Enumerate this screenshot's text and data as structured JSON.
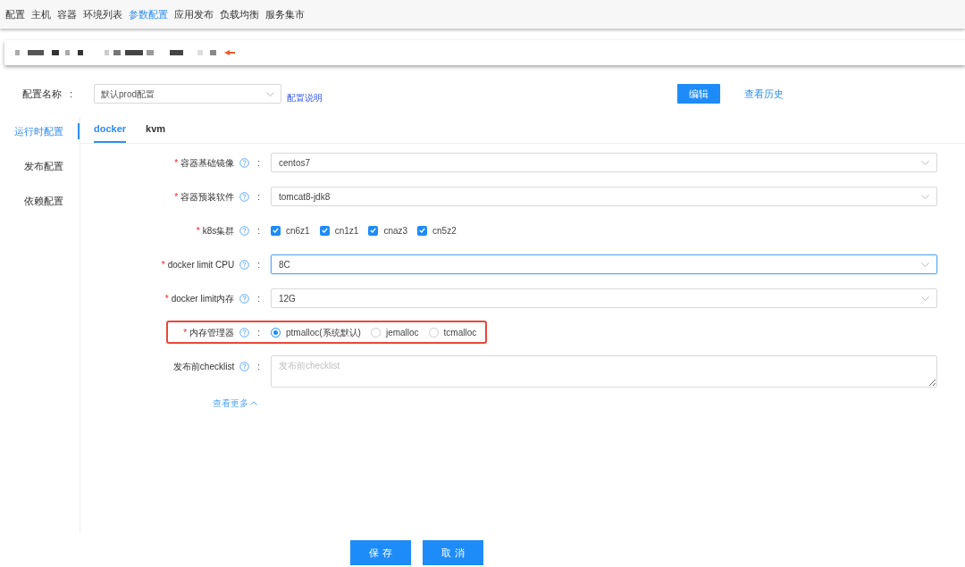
{
  "nav": [
    {
      "label": "配置",
      "selected": false
    },
    {
      "label": "主机",
      "selected": false
    },
    {
      "label": "容器",
      "selected": false
    },
    {
      "label": "环境列表",
      "selected": false
    },
    {
      "label": "参数配置",
      "selected": true
    },
    {
      "label": "应用发布",
      "selected": false
    },
    {
      "label": "负载均衡",
      "selected": false
    },
    {
      "label": "服务集市",
      "selected": false
    }
  ],
  "config_name": {
    "label": "配置名称",
    "colon": ":",
    "value": "默认prod配置",
    "help_link": "配置说明"
  },
  "actions": {
    "edit": "编辑",
    "history": "查看历史"
  },
  "side_tabs": [
    {
      "label": "运行时配置",
      "selected": true
    },
    {
      "label": "发布配置",
      "selected": false
    },
    {
      "label": "依赖配置",
      "selected": false
    }
  ],
  "tabs": [
    {
      "label": "docker",
      "selected": true
    },
    {
      "label": "kvm",
      "selected": false
    }
  ],
  "fields": [
    {
      "kind": "select",
      "required_mark": "*",
      "label": "容器基础镜像",
      "colon": ":",
      "focused": false,
      "highlighted": false,
      "value": "centos7"
    },
    {
      "kind": "select",
      "required_mark": "*",
      "label": "容器预装软件",
      "colon": ":",
      "focused": false,
      "highlighted": false,
      "value": "tomcat8-jdk8"
    },
    {
      "kind": "checkboxes",
      "required_mark": "*",
      "label": "k8s集群",
      "colon": ":",
      "highlighted": false,
      "options": [
        {
          "label": "cn6z1",
          "checked": true
        },
        {
          "label": "cn1z1",
          "checked": true
        },
        {
          "label": "cnaz3",
          "checked": true
        },
        {
          "label": "cn5z2",
          "checked": true
        }
      ]
    },
    {
      "kind": "select",
      "required_mark": "*",
      "label": "docker limit CPU",
      "colon": ":",
      "focused": true,
      "highlighted": false,
      "value": "8C"
    },
    {
      "kind": "select",
      "required_mark": "*",
      "label": "docker limit内存",
      "colon": ":",
      "focused": false,
      "highlighted": false,
      "value": "12G"
    },
    {
      "kind": "radios",
      "required_mark": "*",
      "label": "内存管理器",
      "colon": ":",
      "highlighted": true,
      "options": [
        {
          "label": "ptmalloc(系统默认)",
          "selected": true
        },
        {
          "label": "jemalloc",
          "selected": false
        },
        {
          "label": "tcmalloc",
          "selected": false
        }
      ]
    },
    {
      "kind": "textarea",
      "label": "发布前checklist",
      "colon": ":",
      "highlighted": false,
      "placeholder": "发布前checklist"
    }
  ],
  "more_link": "查看更多",
  "buttons": {
    "save": "保 存",
    "cancel": "取 消"
  }
}
